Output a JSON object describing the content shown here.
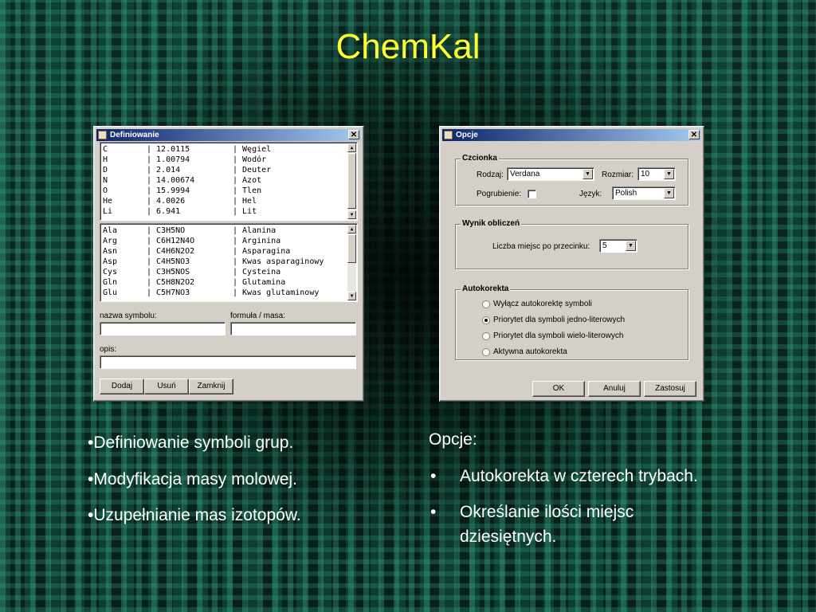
{
  "slide": {
    "title": "ChemKal",
    "left_bullets": [
      "•Definiowanie symboli grup.",
      "•Modyfikacja masy molowej.",
      "•Uzupełnianie mas izotopów."
    ],
    "right_heading": "Opcje:",
    "right_bullets": [
      {
        "marker": "•",
        "text": "Autokorekta w czterech trybach."
      },
      {
        "marker": "•",
        "text": "Określanie ilości miejsc",
        "text2": "dziesiętnych."
      }
    ]
  },
  "definiowanie": {
    "title": "Definiowanie",
    "close": "✕",
    "elements": [
      [
        "C",
        "| 12.0115",
        "| Węgiel"
      ],
      [
        "H",
        "| 1.00794",
        "| Wodór"
      ],
      [
        "D",
        "| 2.014",
        "| Deuter"
      ],
      [
        "N",
        "| 14.00674",
        "| Azot"
      ],
      [
        "O",
        "| 15.9994",
        "| Tlen"
      ],
      [
        "He",
        "| 4.0026",
        "| Hel"
      ],
      [
        "Li",
        "| 6.941",
        "| Lit"
      ]
    ],
    "groups": [
      [
        "Ala",
        "| C3H5NO",
        "| Alanina"
      ],
      [
        "Arg",
        "| C6H12N4O",
        "| Arginina"
      ],
      [
        "Asn",
        "| C4H6N2O2",
        "| Asparagina"
      ],
      [
        "Asp",
        "| C4H5NO3",
        "| Kwas asparaginowy"
      ],
      [
        "Cys",
        "| C3H5NOS",
        "| Cysteina"
      ],
      [
        "Gln",
        "| C5H8N2O2",
        "| Glutamina"
      ],
      [
        "Glu",
        "| C5H7NO3",
        "| Kwas glutaminowy"
      ]
    ],
    "symbol_label": "nazwa symbolu:",
    "symbol_value": "",
    "formula_label": "formuła / masa:",
    "formula_value": "",
    "desc_label": "opis:",
    "desc_value": "",
    "buttons": {
      "add": "Dodaj",
      "remove": "Usuń",
      "close": "Zamknij"
    }
  },
  "opcje": {
    "title": "Opcje",
    "close": "✕",
    "font_group": "Czcionka",
    "font_label": "Rodzaj:",
    "font_value": "Verdana",
    "size_label": "Rozmiar:",
    "size_value": "10",
    "bold_label": "Pogrubienie:",
    "bold_checked": false,
    "lang_label": "Język:",
    "lang_value": "Polish",
    "result_group": "Wynik obliczeń",
    "decimals_label": "Liczba miejsc po przecinku:",
    "decimals_value": "5",
    "autocorrect_group": "Autokorekta",
    "autocorrect_options": [
      {
        "label": "Wyłącz autokorektę symboli",
        "selected": false
      },
      {
        "label": "Priorytet dla symboli jedno-literowych",
        "selected": true
      },
      {
        "label": "Priorytet dla symboli wielo-literowych",
        "selected": false
      },
      {
        "label": "Aktywna autokorekta",
        "selected": false
      }
    ],
    "buttons": {
      "ok": "OK",
      "cancel": "Anuluj",
      "apply": "Zastosuj"
    }
  }
}
